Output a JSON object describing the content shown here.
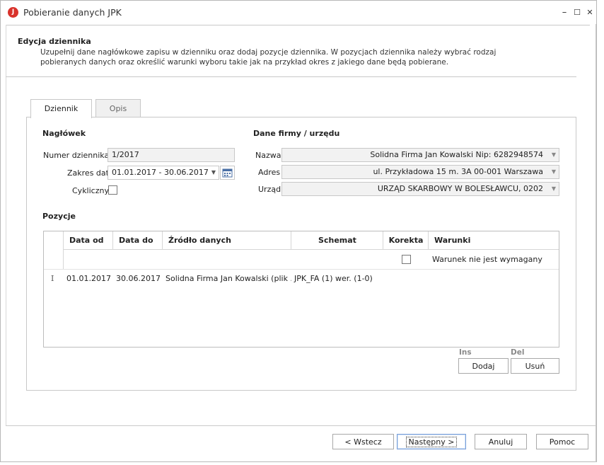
{
  "window": {
    "title": "Pobieranie danych JPK",
    "icon_letter": "J",
    "minimize": "–",
    "maximize": "☐",
    "close": "✕"
  },
  "header": {
    "title": "Edycja dziennika",
    "description": "Uzupełnij dane nagłówkowe zapisu w dzienniku oraz dodaj pozycje dziennika. W pozycjach dziennika należy wybrać rodzaj pobieranych danych oraz określić warunki wyboru takie jak na przykład okres z jakiego dane będą pobierane."
  },
  "tabs": [
    {
      "label": "Dziennik",
      "active": true
    },
    {
      "label": "Opis",
      "active": false
    }
  ],
  "naglowek": {
    "section_title": "Nagłówek",
    "numer_label": "Numer dziennika",
    "numer_value": "1/2017",
    "zakres_label": "Zakres dat",
    "zakres_value": "01.01.2017 - 30.06.2017",
    "cykliczny_label": "Cykliczny",
    "cykliczny_checked": false
  },
  "firma": {
    "section_title": "Dane firmy / urzędu",
    "nazwa_label": "Nazwa",
    "nazwa_value": "Solidna Firma Jan Kowalski Nip: 6282948574",
    "adres_label": "Adres",
    "adres_value": "ul. Przykładowa 15 m. 3A 00-001 Warszawa",
    "urzad_label": "Urząd",
    "urzad_value": "URZĄD SKARBOWY W BOLESŁAWCU, 0202"
  },
  "pozycje": {
    "section_title": "Pozycje",
    "columns": [
      "Data od",
      "Data do",
      "Źródło danych",
      "Schemat",
      "Korekta",
      "Warunki"
    ],
    "rows": [
      {
        "marker": "I",
        "data_od": "01.01.2017",
        "data_do": "30.06.2017",
        "zrodlo": "Solidna Firma Jan Kowalski (plik ...",
        "schemat": "JPK_FA (1) wer. (1-0)",
        "korekta": false,
        "warunki": "Warunek nie jest wymagany"
      }
    ],
    "ins_label": "Ins",
    "del_label": "Del",
    "dodaj_label": "Dodaj",
    "usun_label": "Usuń"
  },
  "footer": {
    "wstecz_label": "< Wstecz",
    "nastepny_label": "Następny >",
    "anuluj_label": "Anuluj",
    "pomoc_label": "Pomoc"
  }
}
